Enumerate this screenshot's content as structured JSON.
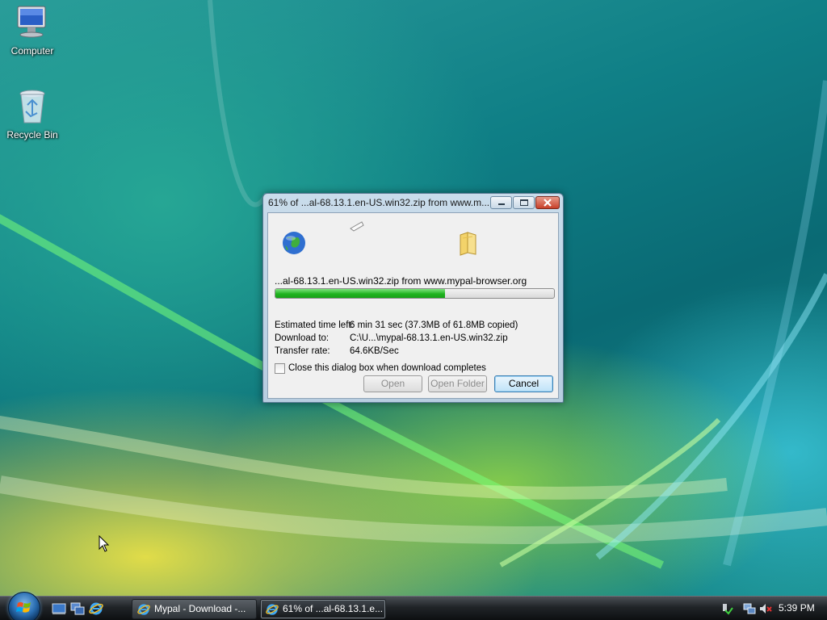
{
  "desktop": {
    "icons": [
      {
        "label": "Computer",
        "icon": "computer-icon"
      },
      {
        "label": "Recycle Bin",
        "icon": "recycle-bin-icon"
      }
    ]
  },
  "dialog": {
    "title": "61% of ...al-68.13.1.en-US.win32.zip from www.m...",
    "file_source": "...al-68.13.1.en-US.win32.zip from www.mypal-browser.org",
    "progress_percent": 61,
    "rows": [
      {
        "label": "Estimated time left:",
        "value": "6 min 31 sec (37.3MB of 61.8MB copied)"
      },
      {
        "label": "Download to:",
        "value": "C:\\U...\\mypal-68.13.1.en-US.win32.zip"
      },
      {
        "label": "Transfer rate:",
        "value": "64.6KB/Sec"
      }
    ],
    "close_checkbox_label": "Close this dialog box when download completes",
    "close_checkbox_checked": false,
    "buttons": {
      "open": "Open",
      "open_folder": "Open Folder",
      "cancel": "Cancel"
    }
  },
  "taskbar": {
    "tasks": [
      {
        "label": "Mypal - Download -...",
        "icon": "ie-icon"
      },
      {
        "label": "61% of ...al-68.13.1.e...",
        "icon": "ie-icon"
      }
    ],
    "clock": "5:39 PM"
  },
  "colors": {
    "progress_green": "#1fb31f",
    "taskbar_dark": "#202428",
    "dialog_frame": "#c9dceb"
  }
}
